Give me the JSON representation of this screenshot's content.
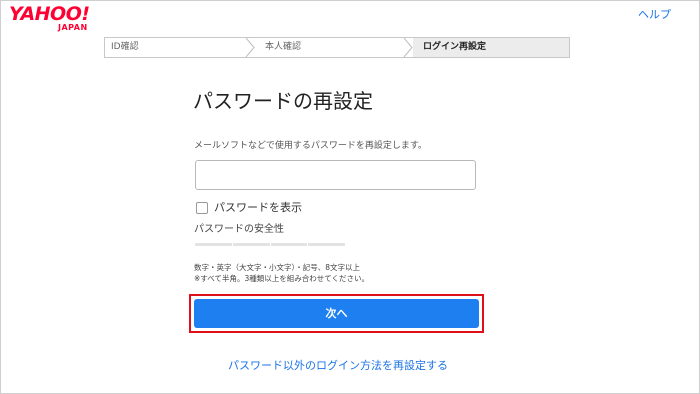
{
  "brand": {
    "logo_text": "YAHOO!",
    "logo_sub": "JAPAN"
  },
  "header": {
    "help_label": "ヘルプ"
  },
  "steps": [
    {
      "label": "ID確認",
      "state": "done"
    },
    {
      "label": "本人確認",
      "state": "done"
    },
    {
      "label": "ログイン再設定",
      "state": "current"
    }
  ],
  "main": {
    "title": "パスワードの再設定",
    "description": "メールソフトなどで使用するパスワードを再設定します。",
    "password_value": "",
    "show_password_label": "パスワードを表示",
    "show_password_checked": false,
    "strength_label": "パスワードの安全性",
    "strength_level": 0,
    "rules_line1": "数字・英字（大文字・小文字）・記号、8文字以上",
    "rules_line2": "※すべて半角。3種類以上を組み合わせてください。",
    "next_label": "次へ",
    "alt_link": "パスワード以外のログイン方法を再設定する"
  },
  "colors": {
    "brand_red": "#ff0033",
    "primary_button": "#1e7ff0",
    "link": "#1a73e8",
    "highlight_outline": "#e0101a"
  }
}
